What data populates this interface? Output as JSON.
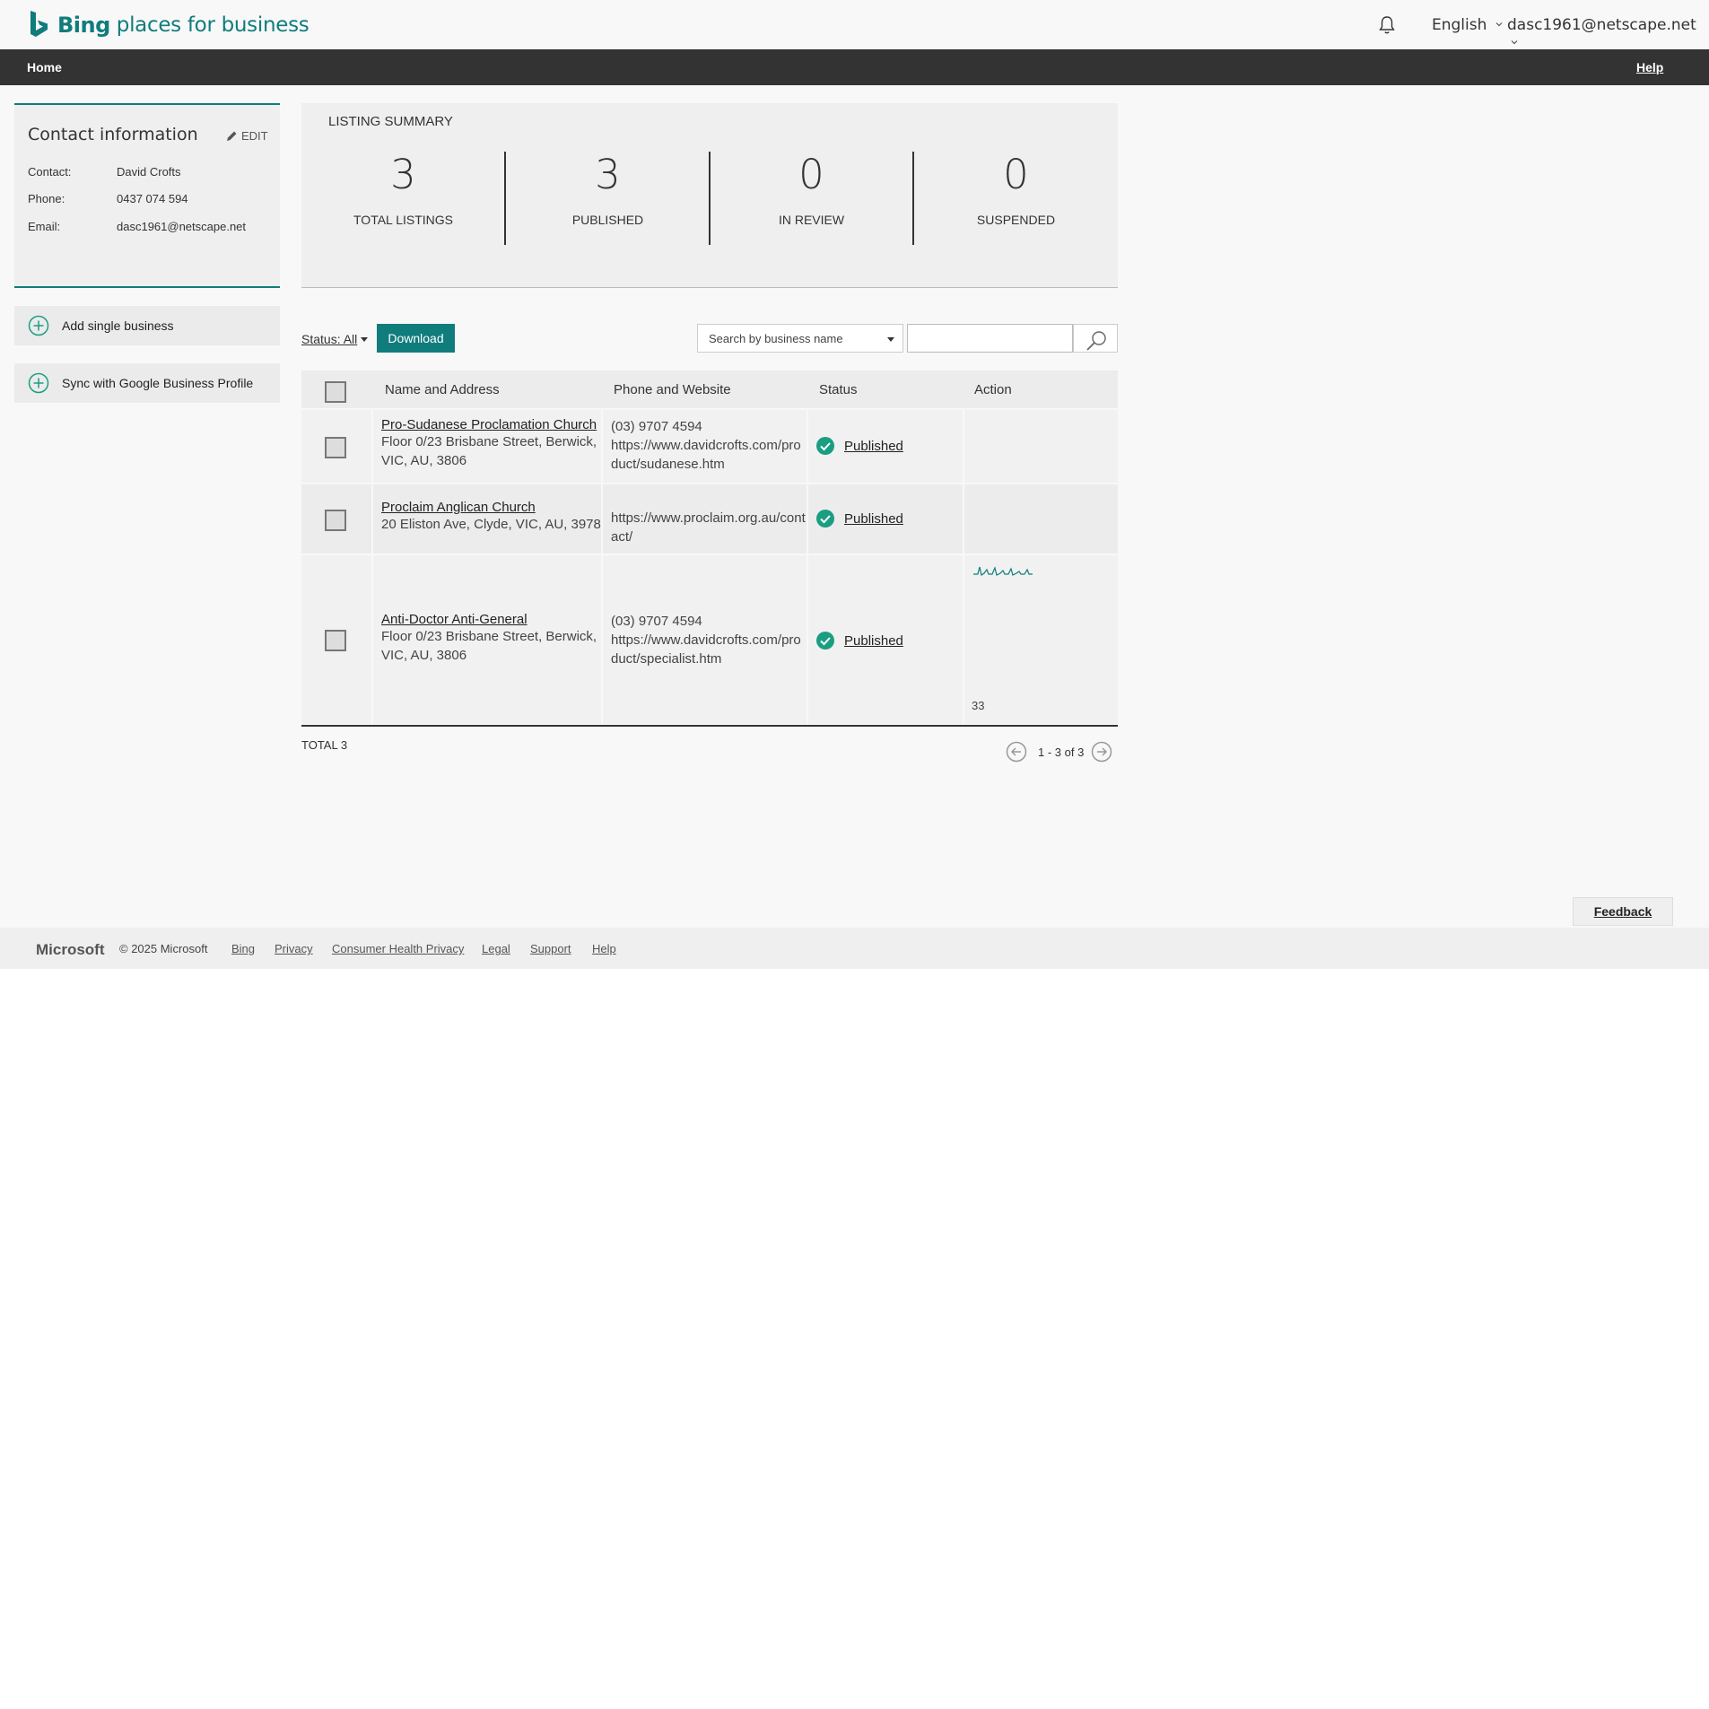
{
  "brand": {
    "bing": "Bing",
    "rest": "places for business",
    "color": "#107c7c"
  },
  "header": {
    "language": "English",
    "user": "dasc1961@netscape.net"
  },
  "nav": {
    "home": "Home",
    "help": "Help"
  },
  "contact": {
    "title": "Contact information",
    "edit": "EDIT",
    "rows": [
      {
        "label": "Contact:",
        "value": "David Crofts"
      },
      {
        "label": "Phone:",
        "value": "0437 074 594"
      },
      {
        "label": "Email:",
        "value": "dasc1961@netscape.net"
      }
    ]
  },
  "actions": {
    "add_single": "Add single business",
    "sync_google": "Sync with Google Business Profile"
  },
  "summary": {
    "title": "LISTING SUMMARY",
    "stats": [
      {
        "value": "3",
        "label": "TOTAL LISTINGS"
      },
      {
        "value": "3",
        "label": "PUBLISHED"
      },
      {
        "value": "0",
        "label": "IN REVIEW"
      },
      {
        "value": "0",
        "label": "SUSPENDED"
      }
    ]
  },
  "toolbar": {
    "status_filter": "Status: All",
    "download": "Download",
    "search_by": "Search by business name",
    "search_value": ""
  },
  "table": {
    "columns": [
      "Name and Address",
      "Phone and Website",
      "Status",
      "Action"
    ],
    "rows": [
      {
        "name": "Pro-Sudanese Proclamation Church",
        "address": "Floor 0/23 Brisbane Street, Berwick, VIC, AU, 3806",
        "phone": "(03) 9707 4594",
        "website": "https://www.davidcrofts.com/product/sudanese.htm",
        "status": "Published",
        "action": ""
      },
      {
        "name": "Proclaim Anglican Church",
        "address": "20 Eliston Ave, Clyde, VIC, AU, 3978",
        "phone": "",
        "website": "https://www.proclaim.org.au/contact/",
        "status": "Published",
        "action": ""
      },
      {
        "name": "Anti-Doctor Anti-General",
        "address": "Floor 0/23 Brisbane Street, Berwick, VIC, AU, 3806",
        "phone": "(03) 9707 4594",
        "website": "https://www.davidcrofts.com/product/specialist.htm",
        "status": "Published",
        "action": "33"
      }
    ],
    "total": "TOTAL 3",
    "pagination": "1 - 3 of 3",
    "status_color": "#1a9e82"
  },
  "feedback": "Feedback",
  "footer": {
    "microsoft": "Microsoft",
    "copyright": "© 2025 Microsoft",
    "links": [
      "Bing",
      "Privacy",
      "Consumer Health Privacy",
      "Legal",
      "Support",
      "Help"
    ]
  }
}
